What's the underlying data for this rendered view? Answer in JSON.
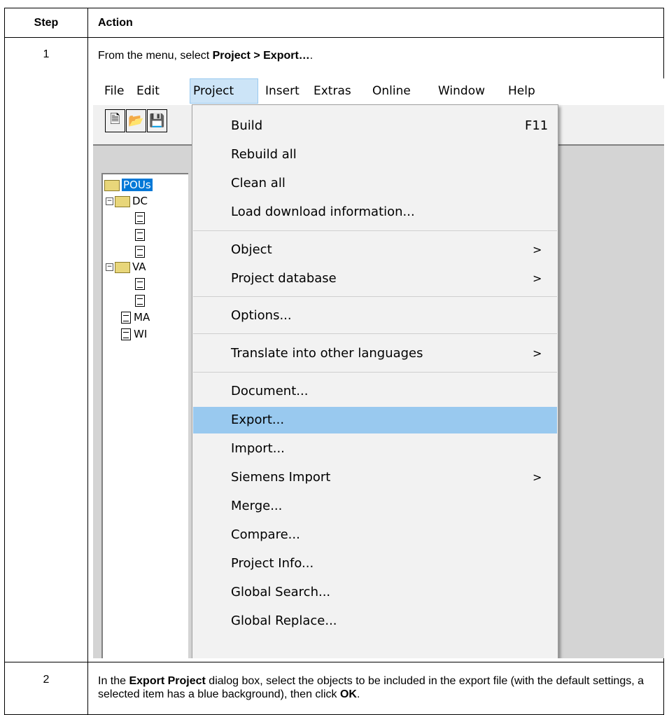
{
  "table": {
    "header_step": "Step",
    "header_action": "Action",
    "rows": [
      {
        "step": "1",
        "text_before": "From the menu, select ",
        "bold_1": "Project",
        "arrow": ">",
        "bold_2": "Export…",
        "text_after": "."
      },
      {
        "step": "2",
        "text_1": "In the ",
        "bold_1": "Export Project",
        "text_2": " dialog box, select the objects to be included in the export file (with the default settings, a selected item has a blue background), then click ",
        "bold_2": "OK",
        "text_3": "."
      }
    ]
  },
  "screenshot": {
    "menubar": [
      "File",
      "Edit",
      "Project",
      "Insert",
      "Extras",
      "Online",
      "Window",
      "Help"
    ],
    "active_menu": "Project",
    "toolbar_icons": [
      "new-file-icon",
      "open-folder-icon",
      "save-icon"
    ],
    "tree": [
      {
        "label": "POUs",
        "selected": true
      },
      {
        "label": "DC"
      },
      {
        "label": ""
      },
      {
        "label": ""
      },
      {
        "label": ""
      },
      {
        "label": "VA"
      },
      {
        "label": ""
      },
      {
        "label": ""
      },
      {
        "label": "MA"
      },
      {
        "label": "WI"
      }
    ],
    "menu_items": [
      {
        "label": "Build",
        "shortcut": "F11"
      },
      {
        "label": "Rebuild all"
      },
      {
        "label": "Clean all"
      },
      {
        "label": "Load download information..."
      },
      {
        "label": "Object",
        "submenu": ">"
      },
      {
        "label": "Project database",
        "submenu": ">"
      },
      {
        "label": "Options..."
      },
      {
        "label": "Translate into other languages",
        "submenu": ">"
      },
      {
        "label": "Document..."
      },
      {
        "label": "Export...",
        "highlighted": true
      },
      {
        "label": "Import..."
      },
      {
        "label": "Siemens Import",
        "submenu": ">"
      },
      {
        "label": "Merge..."
      },
      {
        "label": "Compare..."
      },
      {
        "label": "Project Info..."
      },
      {
        "label": "Global Search..."
      },
      {
        "label": "Global Replace..."
      }
    ],
    "colors": {
      "menu_highlight": "#99c9ef",
      "menubar_active": "#cce4f7",
      "tree_selection": "#0078d7"
    }
  }
}
